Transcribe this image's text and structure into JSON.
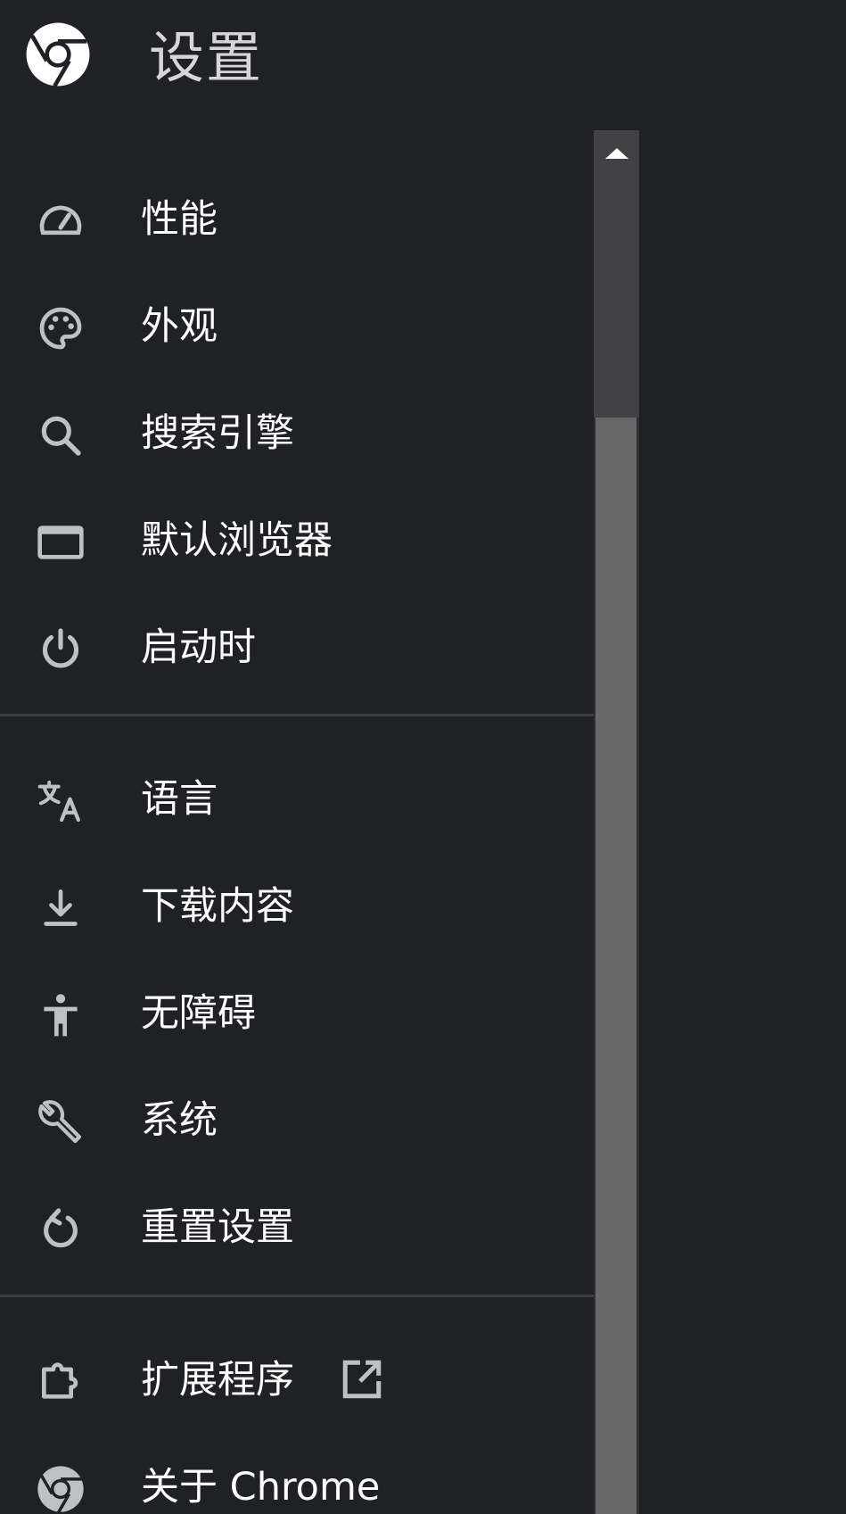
{
  "header": {
    "title": "设置",
    "logo_icon": "chrome-logo-icon"
  },
  "colors": {
    "background": "#202124",
    "text": "#ffffff",
    "icon": "#bdc1c6",
    "divider": "#3d3e41",
    "scroll_thumb": "#686868"
  },
  "sidebar": {
    "groups": [
      {
        "items": [
          {
            "label": "性能",
            "icon": "speedometer-icon"
          },
          {
            "label": "外观",
            "icon": "palette-icon"
          },
          {
            "label": "搜索引擎",
            "icon": "search-icon"
          },
          {
            "label": "默认浏览器",
            "icon": "browser-window-icon"
          },
          {
            "label": "启动时",
            "icon": "power-icon"
          }
        ]
      },
      {
        "items": [
          {
            "label": "语言",
            "icon": "translate-icon"
          },
          {
            "label": "下载内容",
            "icon": "download-icon"
          },
          {
            "label": "无障碍",
            "icon": "accessibility-icon"
          },
          {
            "label": "系统",
            "icon": "wrench-icon"
          },
          {
            "label": "重置设置",
            "icon": "reset-icon"
          }
        ]
      },
      {
        "items": [
          {
            "label": "扩展程序",
            "icon": "puzzle-icon",
            "trailing_icon": "open-in-new-icon"
          },
          {
            "label": "关于 Chrome",
            "icon": "chrome-logo-icon"
          }
        ]
      }
    ]
  }
}
